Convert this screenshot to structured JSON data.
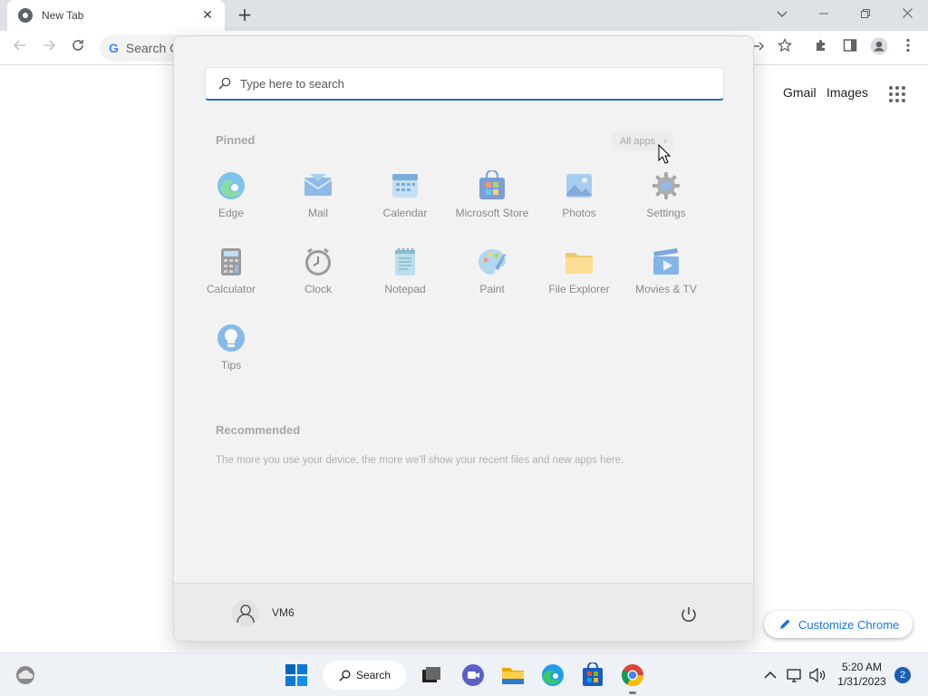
{
  "browser": {
    "tab_title": "New Tab",
    "tab_close": "✕",
    "new_tab": "+",
    "omnibox_placeholder": "Search Google or type a URL",
    "omnibox_visible_text": "Search G"
  },
  "ntp": {
    "gmail": "Gmail",
    "images": "Images",
    "customize_label": "Customize Chrome",
    "accent": "#1a73e8"
  },
  "start_menu": {
    "search_placeholder": "Type here to search",
    "pinned_title": "Pinned",
    "all_apps_label": "All apps",
    "all_apps_chevron": "›",
    "apps": [
      {
        "label": "Edge",
        "icon": "edge-icon"
      },
      {
        "label": "Mail",
        "icon": "mail-icon"
      },
      {
        "label": "Calendar",
        "icon": "calendar-icon"
      },
      {
        "label": "Microsoft Store",
        "icon": "store-icon"
      },
      {
        "label": "Photos",
        "icon": "photos-icon"
      },
      {
        "label": "Settings",
        "icon": "settings-icon"
      },
      {
        "label": "Calculator",
        "icon": "calculator-icon"
      },
      {
        "label": "Clock",
        "icon": "clock-icon"
      },
      {
        "label": "Notepad",
        "icon": "notepad-icon"
      },
      {
        "label": "Paint",
        "icon": "paint-icon"
      },
      {
        "label": "File Explorer",
        "icon": "folder-icon"
      },
      {
        "label": "Movies & TV",
        "icon": "movies-icon"
      },
      {
        "label": "Tips",
        "icon": "tips-icon"
      }
    ],
    "recommended_title": "Recommended",
    "recommended_text": "The more you use your device, the more we'll show your recent files and new apps here.",
    "user_name": "VM6"
  },
  "taskbar": {
    "search_label": "Search",
    "time": "5:20 AM",
    "date": "1/31/2023",
    "notification_count": "2"
  }
}
